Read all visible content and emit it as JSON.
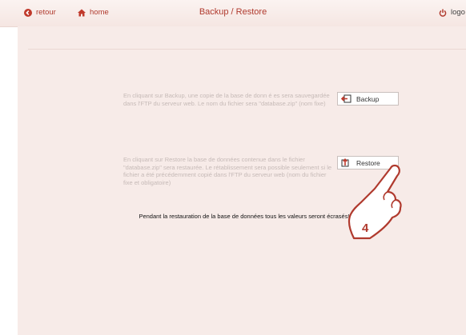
{
  "header": {
    "back_label": "retour",
    "home_label": "home",
    "title": "Backup / Restore",
    "logout_label": "logo"
  },
  "backup": {
    "description": "En cliquant sur Backup, une copie de la base de donn é es sera sauvegardée dans l'FTP du serveur web. Le nom du fichier sera \"database.zip\" (nom fixe)",
    "button_label": "Backup"
  },
  "restore": {
    "description": "En cliquant sur Restore la base de données contenue dans le fichier \"database.zip\" sera restaurée. Le rétablissement sera possible seulement si le fichier a été précédemment copié dans l'FTP du serveur web (nom du fichier fixe et obligatoire)",
    "button_label": "Restore"
  },
  "warning": "Pendant la restauration de la base de données tous les valeurs seront écrasés!",
  "callout": {
    "step_number": "4",
    "icon": "pointing-hand-icon"
  },
  "colors": {
    "accent": "#b03a2e",
    "background": "#f7ebe8",
    "header_bg": "#f8ece9"
  }
}
